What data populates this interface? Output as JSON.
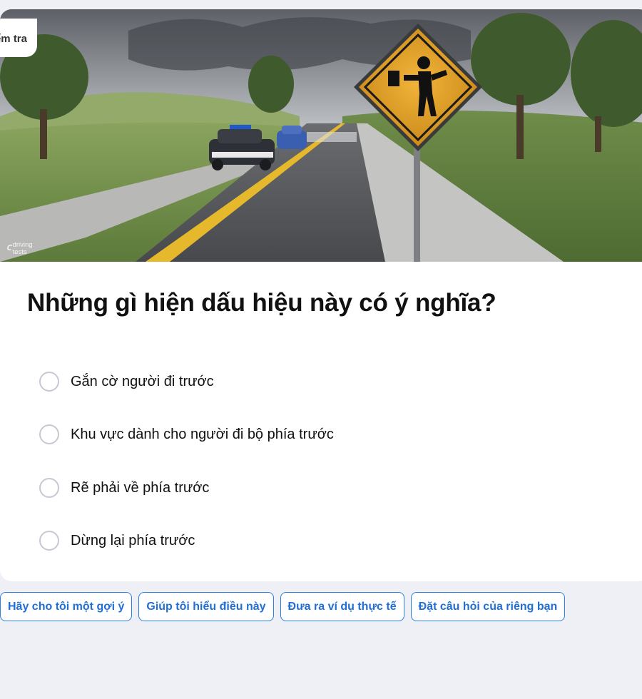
{
  "header": {
    "tag_label": "Kiểm tra",
    "logo_mark": "ꟲ",
    "logo_text": "driving tests"
  },
  "question": {
    "text": "Những gì hiện dấu hiệu này có ý nghĩa?"
  },
  "options": [
    {
      "label": "Gắn cờ người đi trước"
    },
    {
      "label": "Khu vực dành cho người đi bộ phía trước"
    },
    {
      "label": "Rẽ phải về phía trước"
    },
    {
      "label": "Dừng lại phía trước"
    }
  ],
  "actions": [
    {
      "label": "Hãy cho tôi một gợi ý"
    },
    {
      "label": "Giúp tôi hiểu điều này"
    },
    {
      "label": "Đưa ra ví dụ thực tế"
    },
    {
      "label": "Đặt câu hỏi của riêng bạn"
    }
  ],
  "colors": {
    "page_background": "#eff0f5",
    "accent": "#1f6fd6",
    "sign_yellow": "#e8a52a"
  }
}
